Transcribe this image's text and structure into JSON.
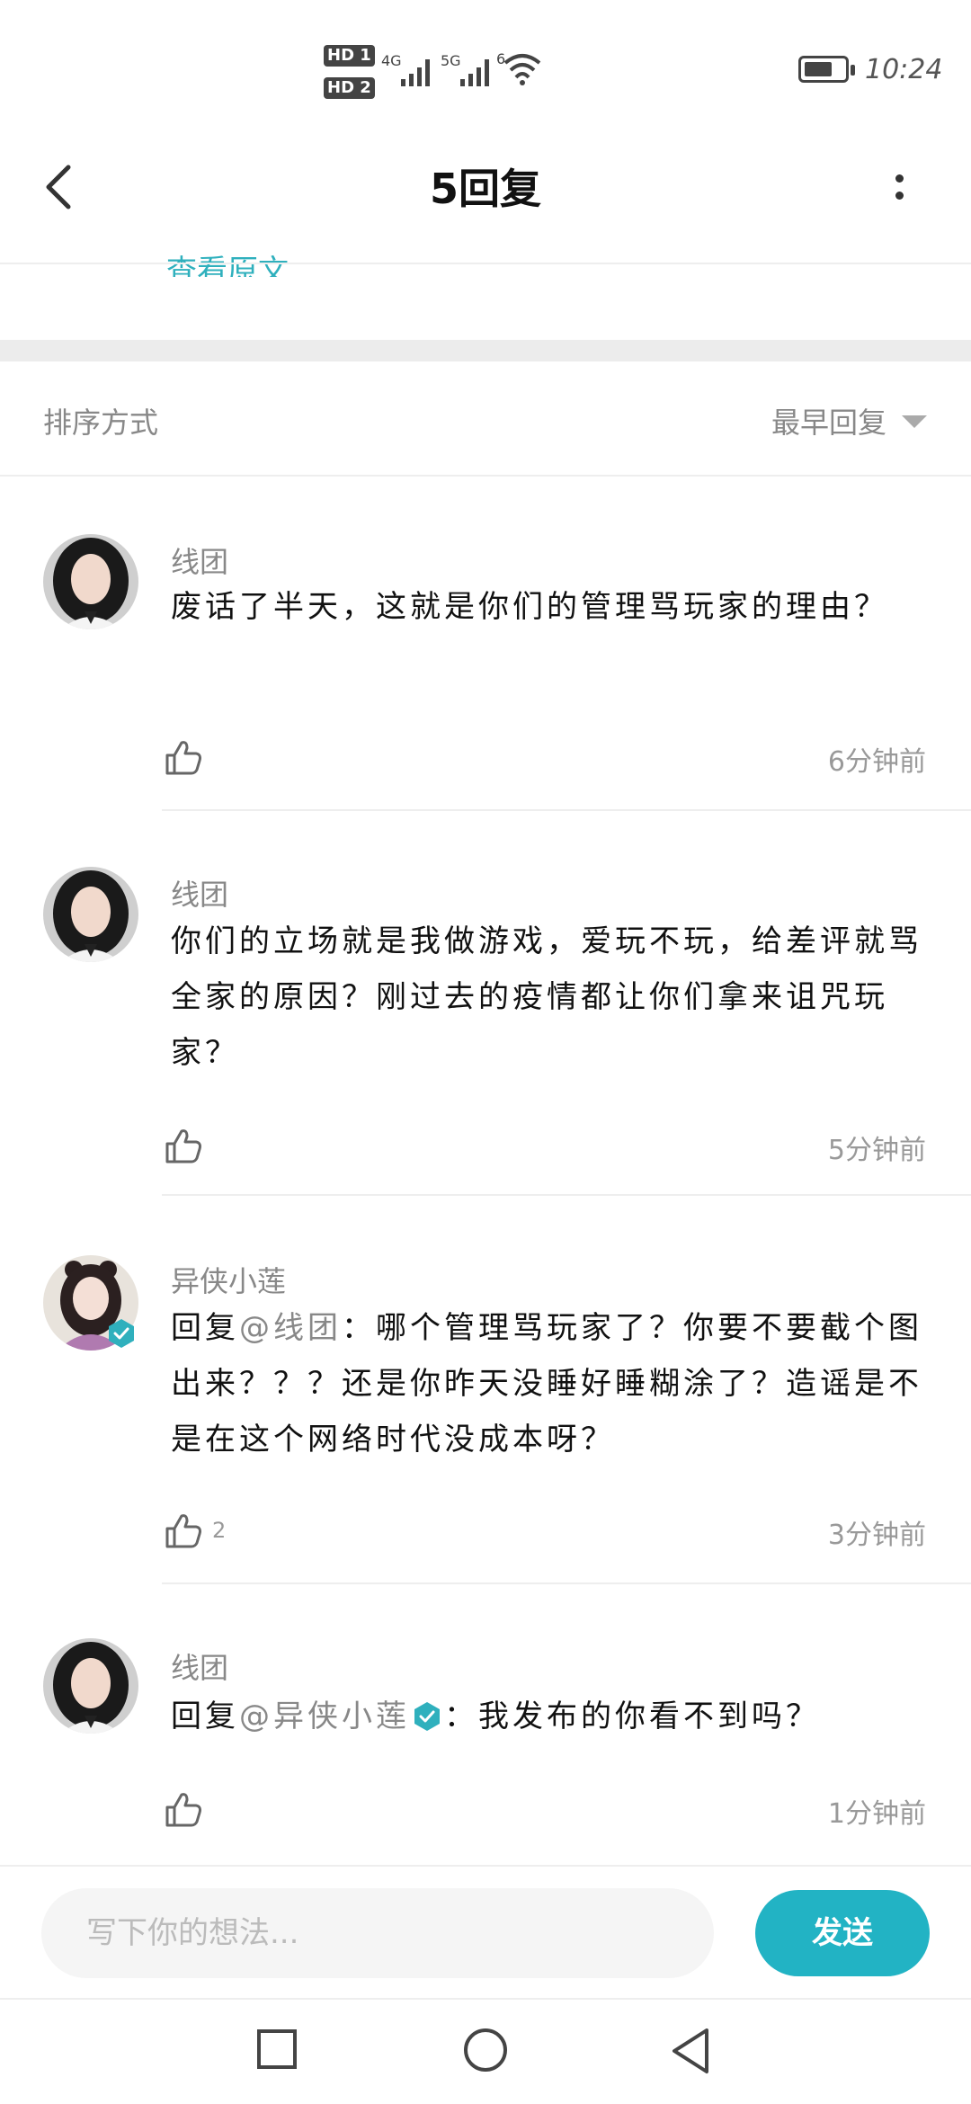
{
  "status_bar": {
    "time": "10:24",
    "hd1": "HD 1",
    "hd2": "HD 2",
    "net1": "4G",
    "net2": "5G",
    "wifi_label": "6"
  },
  "header": {
    "title": "5回复",
    "back_icon": "chevron-left-icon",
    "more_icon": "more-vertical-icon"
  },
  "partial_link": "查看原文",
  "sort": {
    "label": "排序方式",
    "value": "最早回复"
  },
  "comments": [
    {
      "name": "线团",
      "text": "废话了半天，这就是你们的管理骂玩家的理由？",
      "time": "6分钟前",
      "likes": ""
    },
    {
      "name": "线团",
      "text": "你们的立场就是我做游戏，爱玩不玩，给差评就骂全家的原因？刚过去的疫情都让你们拿来诅咒玩家？",
      "time": "5分钟前",
      "likes": ""
    },
    {
      "name": "异侠小莲",
      "prefix": "回复",
      "mention": "@线团",
      "text": "：哪个管理骂玩家了？你要不要截个图出来？？？还是你昨天没睡好睡糊涂了？造谣是不是在这个网络时代没成本呀？",
      "time": "3分钟前",
      "likes": "2",
      "verified": true
    },
    {
      "name": "线团",
      "prefix": "回复",
      "mention": "@异侠小莲",
      "text": "：我发布的你看不到吗？",
      "time": "1分钟前",
      "likes": ""
    }
  ],
  "composer": {
    "placeholder": "写下你的想法...",
    "send_label": "发送"
  },
  "colors": {
    "accent": "#22b3c4",
    "verified": "#2fb0bd"
  }
}
